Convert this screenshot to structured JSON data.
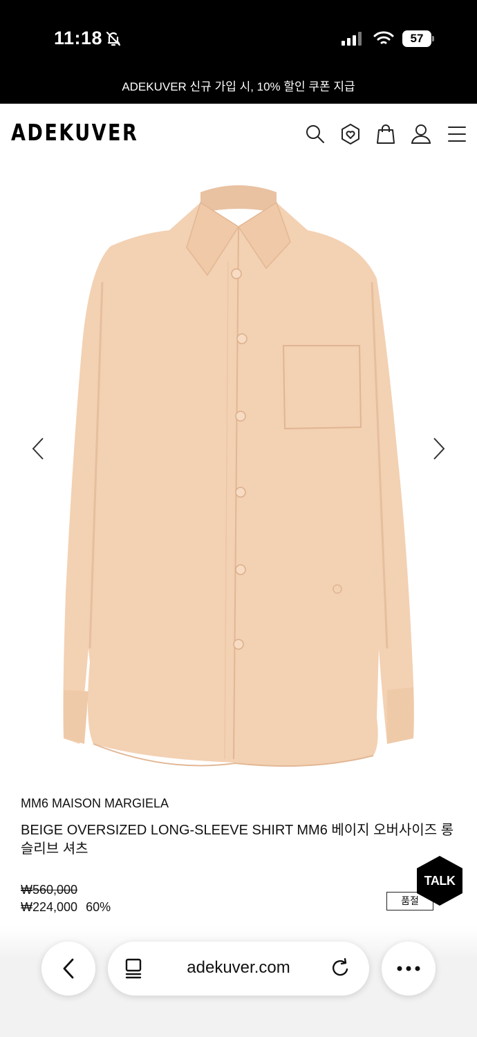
{
  "status": {
    "time": "11:18",
    "battery": "57"
  },
  "promo": {
    "text": "ADEKUVER 신규 가입 시, 10% 할인 쿠폰 지급"
  },
  "header": {
    "logo": "ADEKUVER",
    "icons": [
      "search-icon",
      "wishlist-icon",
      "shopping-bag-icon",
      "user-icon",
      "menu-icon"
    ]
  },
  "product": {
    "brand": "MM6 MAISON MARGIELA",
    "name": "BEIGE OVERSIZED LONG-SLEEVE SHIRT MM6 베이지 오버사이즈 롱 슬리브 셔츠",
    "price_original": "₩560,000",
    "price_sale": "₩224,000",
    "discount": "60%",
    "stock_status": "품절",
    "color_hex": "#f3d1b3"
  },
  "chat": {
    "label": "TALK"
  },
  "browser": {
    "url": "adekuver.com"
  },
  "colors": {
    "topbar": "#000000",
    "accent": "#000000"
  }
}
